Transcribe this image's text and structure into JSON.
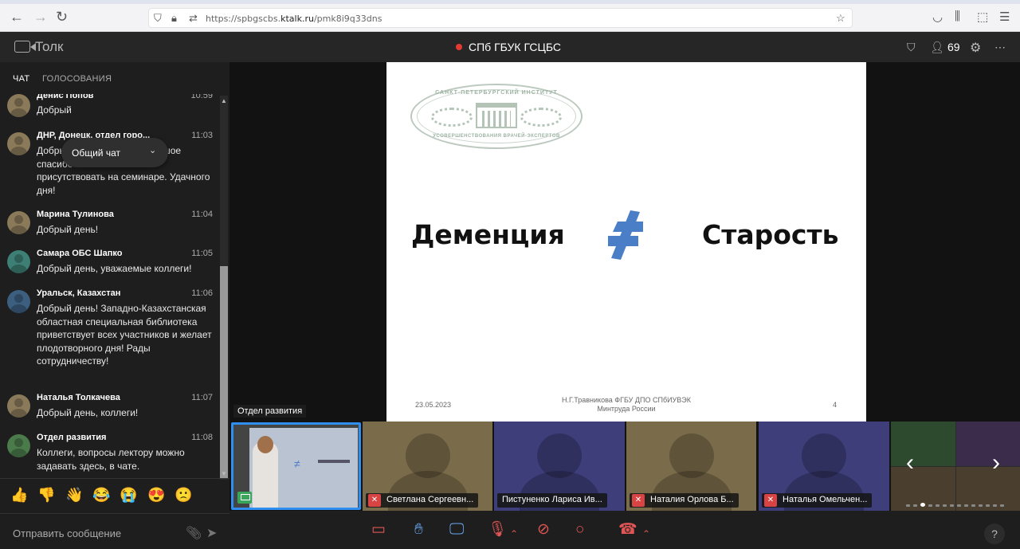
{
  "browser": {
    "url_prefix": "https://spbgscbs.",
    "url_domain": "ktalk.ru",
    "url_path": "/pmk8i9q33dns"
  },
  "app": {
    "name": "Толк",
    "room_title": "СПб ГБУК ГСЦБС",
    "participants_count": "69"
  },
  "sidebar": {
    "tabs": [
      {
        "label": "ЧАТ"
      },
      {
        "label": "ГОЛОСОВАНИЯ"
      }
    ],
    "chat_selector": "Общий чат",
    "messages": [
      {
        "name": "Денис Попов",
        "time": "10:59",
        "text": "Добрый",
        "avatar_color": "#8a7a5a"
      },
      {
        "name": "ДНР, Донецк, отдел горо...",
        "time": "11:03",
        "text": "Добрый день, коллеги! Большое спасибо за возможность присутствовать на семинаре. Удачного дня!",
        "avatar_color": "#8a7a5a"
      },
      {
        "name": "Марина Тулинова",
        "time": "11:04",
        "text": "Добрый день!",
        "avatar_color": "#8a7a5a"
      },
      {
        "name": "Самара ОБС Шапко",
        "time": "11:05",
        "text": "Добрый день, уважаемые коллеги!",
        "avatar_color": "#3d7f74"
      },
      {
        "name": "Уральск, Казахстан",
        "time": "11:06",
        "text": "Добрый день! Западно-Казахстанская областная специальная библиотека приветствует всех участников и желает плодотворного дня! Рады сотрудничеству!",
        "avatar_color": "#3c5f80"
      },
      {
        "name": "Наталья Толкачева",
        "time": "11:07",
        "text": "Добрый день, коллеги!",
        "avatar_color": "#8a7a5a"
      },
      {
        "name": "Отдел развития",
        "time": "11:08",
        "text": "Коллеги, вопросы лектору можно задавать здесь, в чате.",
        "avatar_color": "#4b7a4b"
      }
    ],
    "reactions": [
      "👍",
      "👎",
      "👋",
      "😂",
      "😭",
      "😍",
      "🙁"
    ],
    "send_placeholder": "Отправить сообщение"
  },
  "slide": {
    "seal_top": "САНКТ-ПЕТЕРБУРГСКИЙ ИНСТИТУТ",
    "seal_bottom": "УСОВЕРШЕНСТВОВАНИЯ ВРАЧЕЙ-ЭКСПЕРТОВ",
    "word_left": "Деменция",
    "word_right": "Старость",
    "date": "23.05.2023",
    "author_line1": "Н.Г.Травникова ФГБУ ДПО СПбИУВЭК",
    "author_line2": "Минтруда России",
    "page": "4"
  },
  "speaker_label": "Отдел развития",
  "tiles": [
    {
      "name": "Светлана Сергеевн...",
      "color": "#7a6b4a",
      "muted": true
    },
    {
      "name": "Пистуненко Лариса Ив...",
      "color": "#3e3e7a",
      "muted": false
    },
    {
      "name": "Наталия Орлова Б...",
      "color": "#7a6b4a",
      "muted": true
    },
    {
      "name": "Наталья Омельчен...",
      "color": "#3e3e7a",
      "muted": true
    }
  ]
}
